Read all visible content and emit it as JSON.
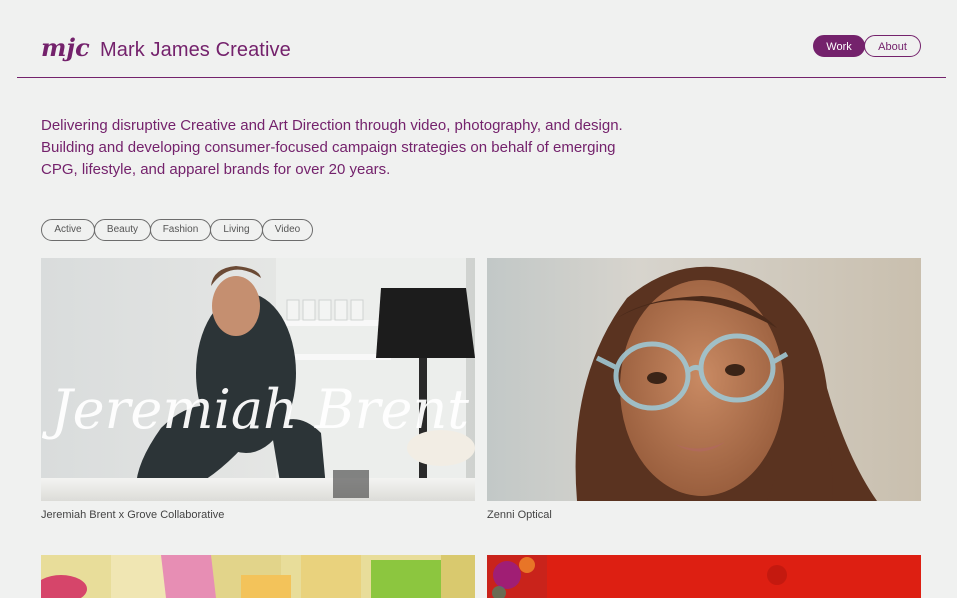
{
  "header": {
    "logo_text": "mjc",
    "brand_name": "Mark James Creative",
    "nav": [
      {
        "label": "Work",
        "active": true
      },
      {
        "label": "About",
        "active": false
      }
    ]
  },
  "intro": {
    "lines": [
      "Delivering disruptive Creative and Art Direction through video, photography, and design.",
      "Building and developing consumer-focused campaign strategies on behalf of emerging",
      "CPG, lifestyle, and apparel brands for over 20 years."
    ]
  },
  "filters": [
    "Active",
    "Beauty",
    "Fashion",
    "Living",
    "Video"
  ],
  "projects": [
    {
      "caption": "Jeremiah Brent x Grove Collaborative",
      "overlay_text": "Jeremiah Brent"
    },
    {
      "caption": "Zenni Optical"
    },
    {
      "caption": ""
    },
    {
      "caption": ""
    }
  ],
  "colors": {
    "accent": "#74226c",
    "background": "#f0f1f0"
  }
}
